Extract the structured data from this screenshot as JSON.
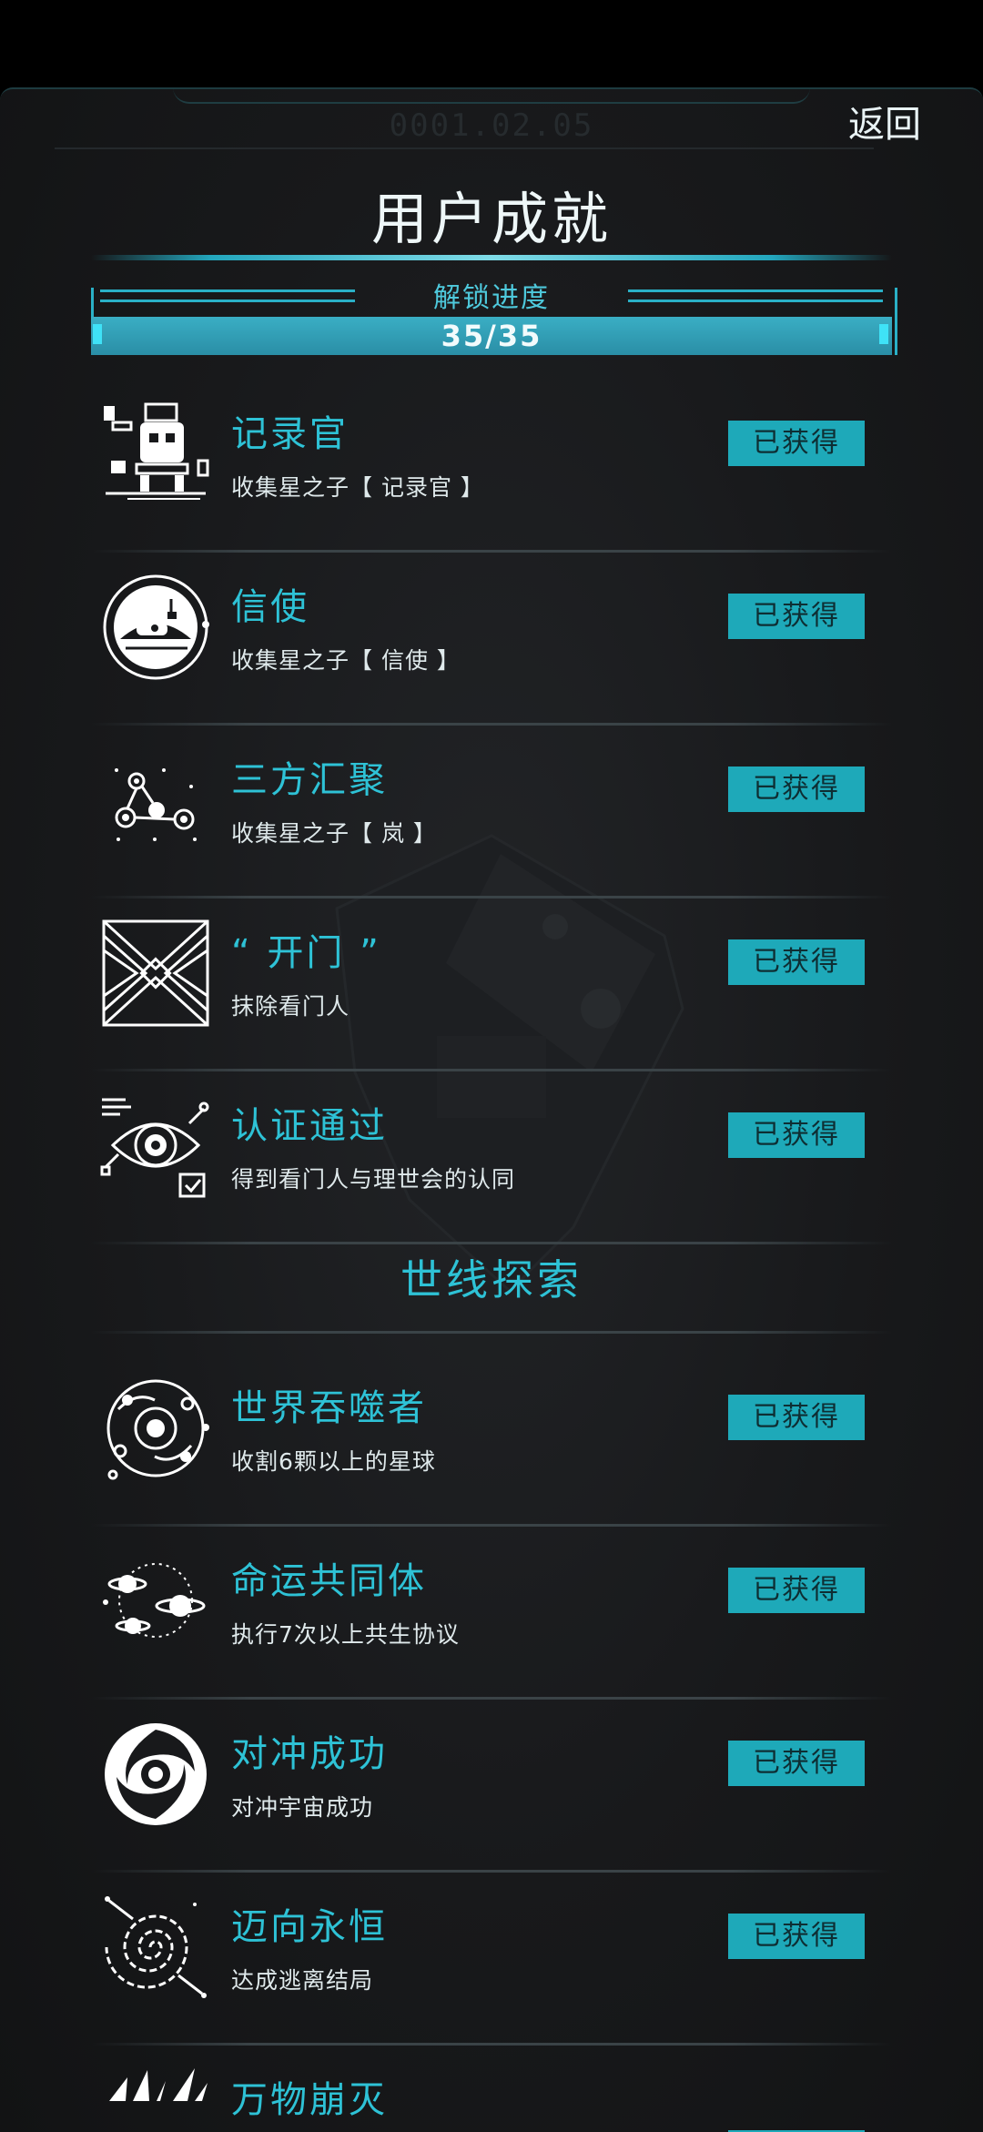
{
  "header": {
    "back_label": "返回",
    "ghost_code": "0001.02.05",
    "title": "用户成就"
  },
  "progress": {
    "label": "解锁进度",
    "value_text": "35/35",
    "fraction": 1.0
  },
  "section": {
    "title": "世线探索"
  },
  "colors": {
    "accent": "#2ec2d6",
    "badge_bg": "#1ea9b9",
    "background": "#18191b"
  },
  "achievements": [
    {
      "name": "记录官",
      "desc": "收集星之子【 记录官 】",
      "status": "已获得",
      "icon": "robot-icon"
    },
    {
      "name": "信使",
      "desc": "收集星之子【 信使 】",
      "status": "已获得",
      "icon": "messenger-ship-icon"
    },
    {
      "name": "三方汇聚",
      "desc": "收集星之子【 岚 】",
      "status": "已获得",
      "icon": "constellation-icon"
    },
    {
      "name": "“ 开门 ”",
      "desc": "抹除看门人",
      "status": "已获得",
      "icon": "door-icon"
    },
    {
      "name": "认证通过",
      "desc": "得到看门人与理世会的认同",
      "status": "已获得",
      "icon": "eye-check-icon"
    },
    {
      "name": "世界吞噬者",
      "desc": "收割6颗以上的星球",
      "status": "已获得",
      "icon": "world-devourer-icon"
    },
    {
      "name": "命运共同体",
      "desc": "执行7次以上共生协议",
      "status": "已获得",
      "icon": "orbit-planets-icon"
    },
    {
      "name": "对冲成功",
      "desc": "对冲宇宙成功",
      "status": "已获得",
      "icon": "vortex-icon"
    },
    {
      "name": "迈向永恒",
      "desc": "达成逃离结局",
      "status": "已获得",
      "icon": "spiral-galaxy-icon"
    },
    {
      "name": "万物崩灭",
      "status": "",
      "icon": "shatter-icon"
    }
  ]
}
